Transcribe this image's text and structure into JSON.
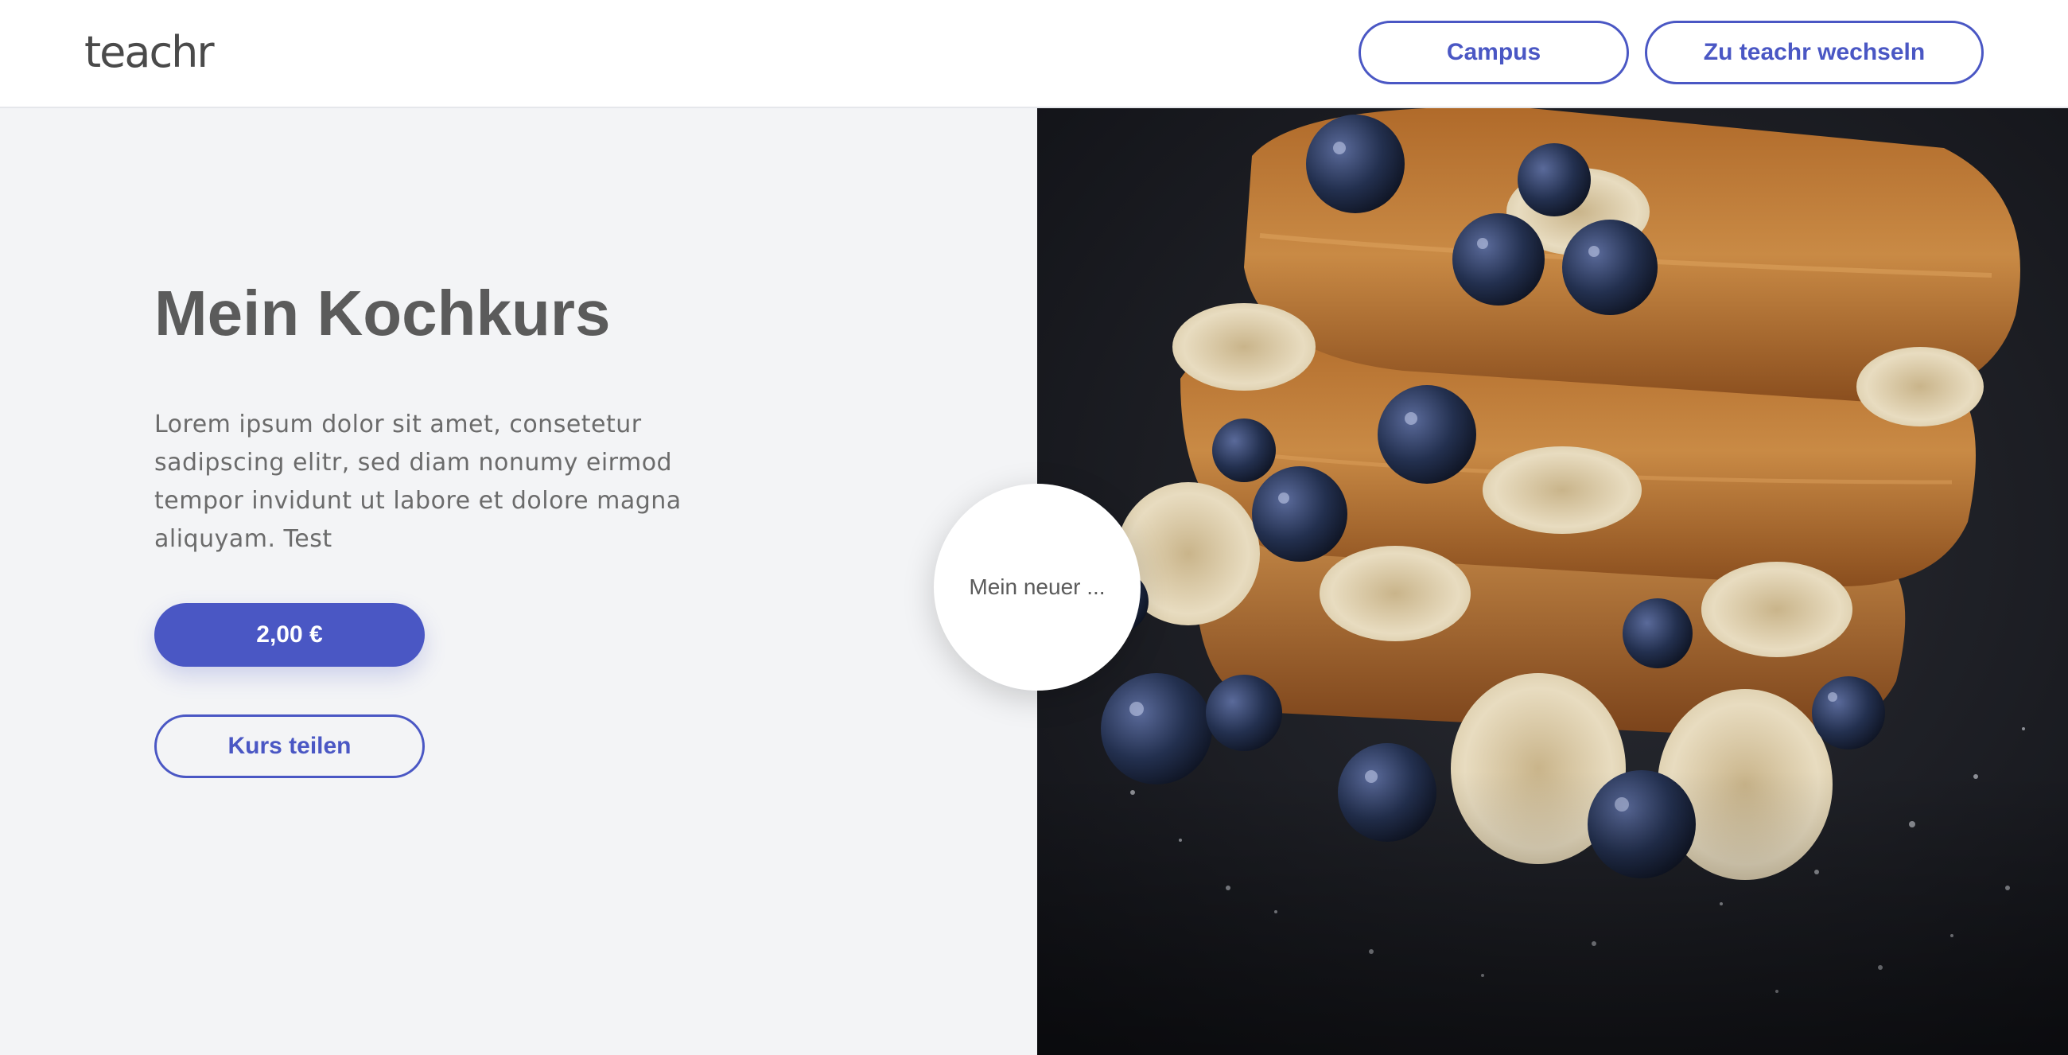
{
  "header": {
    "logo": "teachr",
    "campus_label": "Campus",
    "switch_label": "Zu teachr wechseln"
  },
  "course": {
    "title": "Mein Kochkurs",
    "description": "Lorem ipsum dolor sit amet, consetetur sadipscing elitr, sed diam nonumy eirmod tempor invidunt ut labore et dolore magna aliquyam. Test",
    "price_label": "2,00 €",
    "share_label": "Kurs teilen"
  },
  "badge": {
    "text": "Mein neuer ..."
  },
  "hero_image": {
    "icon": "french-toast-photo"
  },
  "colors": {
    "accent": "#4a57c4",
    "panel_bg": "#f3f4f6",
    "text_dark": "#5b5b5b",
    "topbar_bg": "#ffffff",
    "hero_bg": "#1a1c22"
  }
}
